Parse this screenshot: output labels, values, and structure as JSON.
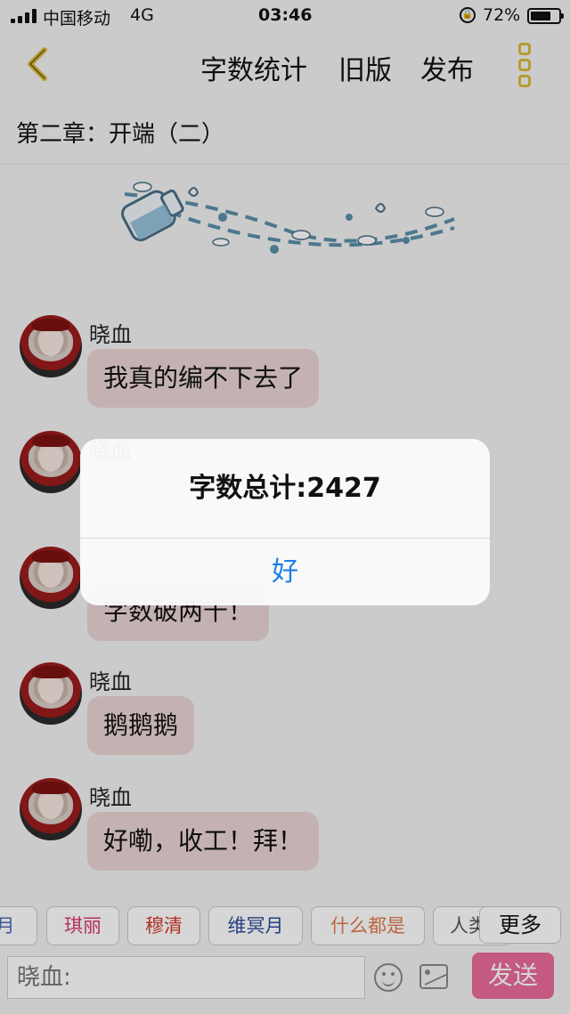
{
  "status_bar": {
    "carrier": "中国移动",
    "network": "4G",
    "time": "03:46",
    "battery_percent": "72%",
    "battery_level": 0.72
  },
  "nav": {
    "word_count_label": "字数统计",
    "old_version_label": "旧版",
    "publish_label": "发布",
    "accent_color": "#d8bb3a"
  },
  "chapter_title": "第二章：开端（二）",
  "messages": [
    {
      "sender": "晓血",
      "text": "我真的编不下去了"
    },
    {
      "sender": "晓血",
      "text": ""
    },
    {
      "sender": "",
      "text": "字数破两千！"
    },
    {
      "sender": "晓血",
      "text": "鹅鹅鹅"
    },
    {
      "sender": "晓血",
      "text": "好嘞，收工！拜！"
    }
  ],
  "quick_tags": [
    {
      "label": "月",
      "color": "#4a6bb8"
    },
    {
      "label": "琪丽",
      "color": "#d9386a"
    },
    {
      "label": "穆清",
      "color": "#d43a2a"
    },
    {
      "label": "维冥月",
      "color": "#2a4a9a"
    },
    {
      "label": "什么都是",
      "color": "#e07a4a"
    },
    {
      "label": "人类",
      "color": "#555555"
    }
  ],
  "more_label": "更多",
  "input": {
    "placeholder": "晓血:"
  },
  "send_label": "发送",
  "send_color": "#ea6a9a",
  "alert": {
    "message": "字数总计:2427",
    "button_label": "好",
    "button_color": "#1e7ee8"
  }
}
